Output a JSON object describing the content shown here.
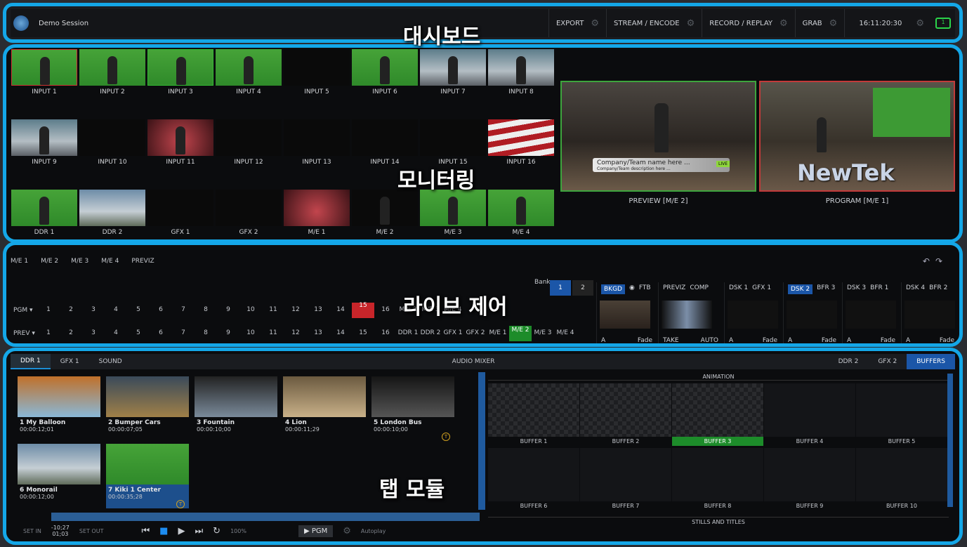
{
  "overlays": {
    "dashboard": "대시보드",
    "monitoring": "모니터링",
    "live_control": "라이브 제어",
    "tab_modules": "탭 모듈"
  },
  "dashboard": {
    "session": "Demo Session",
    "items": [
      "EXPORT",
      "STREAM / ENCODE",
      "RECORD / REPLAY",
      "GRAB"
    ],
    "clock": "16:11:20:30",
    "chat_count": "1"
  },
  "monitoring": {
    "inputs": [
      "INPUT 1",
      "INPUT 2",
      "INPUT 3",
      "INPUT 4",
      "INPUT 5",
      "INPUT 6",
      "INPUT 7",
      "INPUT 8",
      "INPUT 9",
      "INPUT 10",
      "INPUT 11",
      "INPUT 12",
      "INPUT 13",
      "INPUT 14",
      "INPUT 15",
      "INPUT 16"
    ],
    "bottom": [
      "DDR 1",
      "DDR 2",
      "GFX 1",
      "GFX 2",
      "M/E 1",
      "M/E 2",
      "M/E 3",
      "M/E 4"
    ],
    "preview_label": "PREVIEW [M/E 2]",
    "program_label": "PROGRAM [M/E 1]",
    "ticker_title": "Company/Team name here ...",
    "ticker_sub": "Company/Team description here ...",
    "live_tag": "LIVE",
    "logo": "NewTek"
  },
  "live": {
    "tabs": [
      "M/E 1",
      "M/E 2",
      "M/E 3",
      "M/E 4",
      "PREVIZ"
    ],
    "pgm_label": "PGM ▾",
    "prev_label": "PREV ▾",
    "numbers": [
      "1",
      "2",
      "3",
      "4",
      "5",
      "6",
      "7",
      "8",
      "9",
      "10",
      "11",
      "12",
      "13",
      "14",
      "15",
      "16"
    ],
    "prev_extra": [
      "DDR 1",
      "DDR 2",
      "GFX 1",
      "GFX 2",
      "M/E 1",
      "M/E 2",
      "M/E 3",
      "M/E 4"
    ],
    "pgm_extra": [
      "M/E 2",
      "M/E 3",
      "M/E 4"
    ],
    "bank_label": "Bank",
    "bank_1": "1",
    "bank_2": "2",
    "bkgd": "BKGD",
    "ftb": "FTB",
    "previz": "PREVIZ",
    "comp": "COMP",
    "take": "TAKE",
    "auto": "AUTO",
    "fade": "Fade",
    "dsk": [
      {
        "a": "DSK 1",
        "b": "GFX 1"
      },
      {
        "a": "DSK 2",
        "b": "BFR 3"
      },
      {
        "a": "DSK 3",
        "b": "BFR 1"
      },
      {
        "a": "DSK 4",
        "b": "BFR 2"
      }
    ]
  },
  "modules": {
    "tabs_left": [
      "DDR 1",
      "GFX 1",
      "SOUND"
    ],
    "audio_mixer": "AUDIO MIXER",
    "tabs_right": [
      "DDR 2",
      "GFX 2",
      "BUFFERS"
    ],
    "clips": [
      {
        "name": "1 My Balloon",
        "time": "00:00:12;01"
      },
      {
        "name": "2 Bumper Cars",
        "time": "00:00:07;05"
      },
      {
        "name": "3 Fountain",
        "time": "00:00:10;00"
      },
      {
        "name": "4 Lion",
        "time": "00:00:11;29"
      },
      {
        "name": "5 London Bus",
        "time": "00:00:10;00"
      },
      {
        "name": "6 Monorail",
        "time": "00:00:12;00"
      },
      {
        "name": "7 Kiki 1 Center",
        "time": "00:00:35;28"
      }
    ],
    "set_in": "SET IN",
    "remaining": "-10;27",
    "duration": "01;03",
    "set_out": "SET OUT",
    "speed": "100%",
    "pgm_btn": "▶ PGM",
    "autoplay": "Autoplay",
    "animation": "ANIMATION",
    "stills": "STILLS AND TITLES",
    "buffers": [
      "BUFFER 1",
      "BUFFER 2",
      "BUFFER 3",
      "BUFFER 4",
      "BUFFER 5",
      "BUFFER 6",
      "BUFFER 7",
      "BUFFER 8",
      "BUFFER 9",
      "BUFFER 10"
    ]
  }
}
